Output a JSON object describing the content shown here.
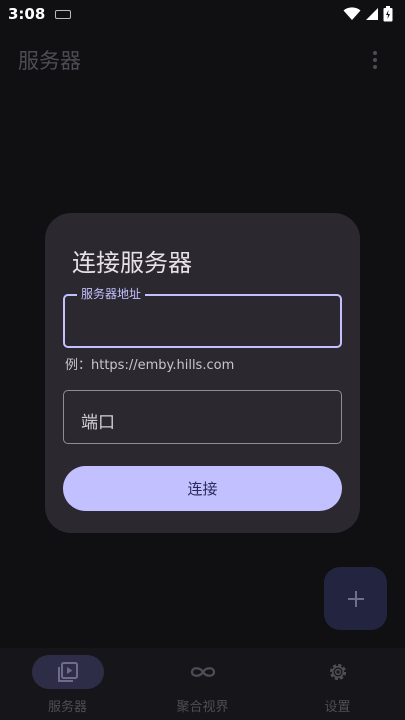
{
  "status_bar": {
    "time": "3:08"
  },
  "app_bar": {
    "title": "服务器"
  },
  "dialog": {
    "title": "连接服务器",
    "server_field_label": "服务器地址",
    "server_field_value": "",
    "hint": "例：https://emby.hills.com",
    "port_field_label": "端口",
    "connect_label": "连接"
  },
  "bottom_nav": {
    "items": [
      {
        "label": "服务器",
        "icon": "server-playlist-icon",
        "active": true
      },
      {
        "label": "聚合视界",
        "icon": "infinity-icon",
        "active": false
      },
      {
        "label": "设置",
        "icon": "gear-icon",
        "active": false
      }
    ]
  },
  "colors": {
    "accent": "#c3c0ff",
    "button_bg": "#c2c0ff",
    "dialog_bg": "#2b292f",
    "background": "#101012"
  }
}
